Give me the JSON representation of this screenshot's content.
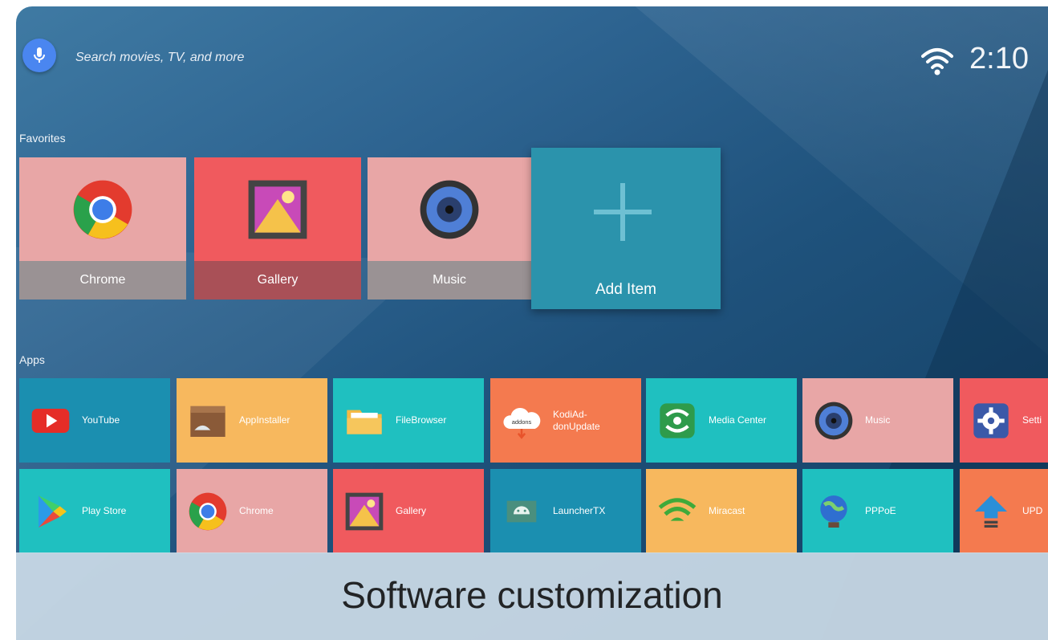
{
  "search": {
    "placeholder_text": "Search movies, TV, and more",
    "mic_icon": "mic-icon"
  },
  "status": {
    "time": "2:10",
    "wifi_icon": "wifi-icon"
  },
  "favorites": {
    "title": "Favorites",
    "items": [
      {
        "label": "Chrome",
        "icon": "chrome-icon",
        "bg": "#e8a6a6",
        "label_bg": "#9a9294"
      },
      {
        "label": "Gallery",
        "icon": "gallery-icon",
        "bg": "#f05a5e",
        "label_bg": "#a95057"
      },
      {
        "label": "Music",
        "icon": "speaker-icon",
        "bg": "#e8a6a6",
        "label_bg": "#9a9294"
      }
    ],
    "add_item": {
      "label": "Add Item",
      "icon": "plus-icon"
    }
  },
  "apps": {
    "title": "Apps",
    "row1": [
      {
        "label": "YouTube",
        "icon": "youtube-icon",
        "bg": "#1b8fb0"
      },
      {
        "label": "AppInstaller",
        "icon": "box-icon",
        "bg": "#f7b85e"
      },
      {
        "label": "FileBrowser",
        "icon": "folder-icon",
        "bg": "#1fc0c0"
      },
      {
        "label": "KodiAd-\ndonUpdate",
        "icon": "cloud-icon",
        "icon_text": "addons",
        "bg": "#f47a4f"
      },
      {
        "label": "Media Center",
        "icon": "media-center-icon",
        "bg": "#1fc0c0"
      },
      {
        "label": "Music",
        "icon": "speaker-icon",
        "bg": "#e8a6a6"
      },
      {
        "label": "Setti",
        "icon": "settings-icon",
        "bg": "#f05a5e"
      }
    ],
    "row2": [
      {
        "label": "Play Store",
        "icon": "play-store-icon",
        "bg": "#1fc0c0"
      },
      {
        "label": "Chrome",
        "icon": "chrome-icon",
        "bg": "#e8a6a6"
      },
      {
        "label": "Gallery",
        "icon": "gallery-icon",
        "bg": "#f05a5e"
      },
      {
        "label": "LauncherTX",
        "icon": "android-icon",
        "bg": "#1b8fb0"
      },
      {
        "label": "Miracast",
        "icon": "wifi-icon",
        "bg": "#f7b85e"
      },
      {
        "label": "PPPoE",
        "icon": "globe-icon",
        "bg": "#1fc0c0"
      },
      {
        "label": "UPD",
        "icon": "upload-icon",
        "bg": "#f47a4f"
      }
    ]
  },
  "banner": {
    "text": "Software customization"
  }
}
